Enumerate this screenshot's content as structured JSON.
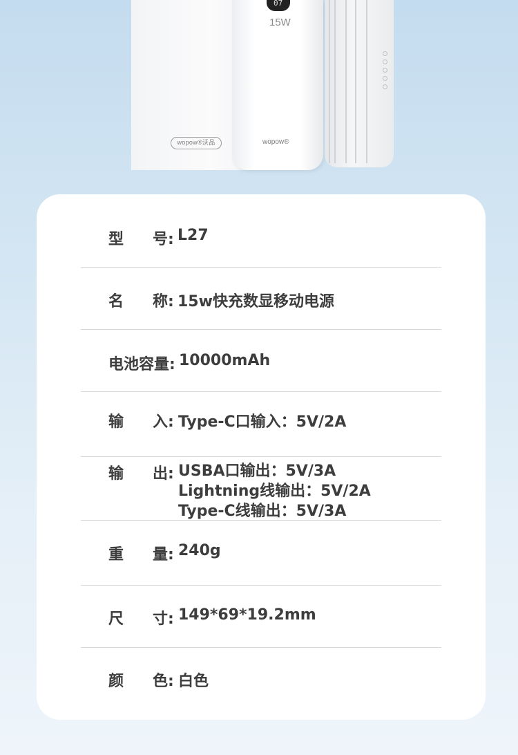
{
  "product_image": {
    "box_logo": "wopow®沃品",
    "display_digits": "07",
    "wattage": "15W",
    "device_logo": "wopow®"
  },
  "specs": [
    {
      "name_a": "型",
      "name_b": "号",
      "colon": ":",
      "value": "L27"
    },
    {
      "name_a": "名",
      "name_b": "称",
      "colon": ":",
      "value": "15w快充数显移动电源"
    },
    {
      "name": "电池容量",
      "colon": ":",
      "value": "10000mAh"
    },
    {
      "name_a": "输",
      "name_b": "入",
      "colon": ":",
      "value": "Type-C口输入：5V/2A"
    },
    {
      "name_a": "输",
      "name_b": "出",
      "colon": ":",
      "values": [
        "USBA口输出：5V/3A",
        "Lightning线输出：5V/2A",
        "Type-C线输出：5V/3A"
      ]
    },
    {
      "name_a": "重",
      "name_b": "量",
      "colon": ":",
      "value": "240g"
    },
    {
      "name_a": "尺",
      "name_b": "寸",
      "colon": ":",
      "value": "149*69*19.2mm"
    },
    {
      "name_a": "颜",
      "name_b": "色",
      "colon": ":",
      "value": "白色"
    }
  ]
}
